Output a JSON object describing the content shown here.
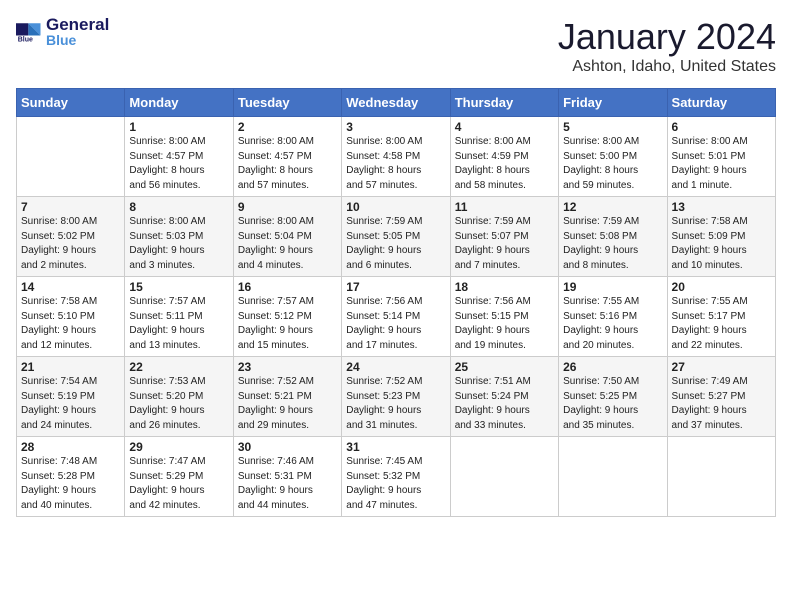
{
  "header": {
    "logo_general": "General",
    "logo_blue": "Blue",
    "month_title": "January 2024",
    "location": "Ashton, Idaho, United States"
  },
  "days_of_week": [
    "Sunday",
    "Monday",
    "Tuesday",
    "Wednesday",
    "Thursday",
    "Friday",
    "Saturday"
  ],
  "weeks": [
    [
      {
        "day": "",
        "detail": ""
      },
      {
        "day": "1",
        "detail": "Sunrise: 8:00 AM\nSunset: 4:57 PM\nDaylight: 8 hours\nand 56 minutes."
      },
      {
        "day": "2",
        "detail": "Sunrise: 8:00 AM\nSunset: 4:57 PM\nDaylight: 8 hours\nand 57 minutes."
      },
      {
        "day": "3",
        "detail": "Sunrise: 8:00 AM\nSunset: 4:58 PM\nDaylight: 8 hours\nand 57 minutes."
      },
      {
        "day": "4",
        "detail": "Sunrise: 8:00 AM\nSunset: 4:59 PM\nDaylight: 8 hours\nand 58 minutes."
      },
      {
        "day": "5",
        "detail": "Sunrise: 8:00 AM\nSunset: 5:00 PM\nDaylight: 8 hours\nand 59 minutes."
      },
      {
        "day": "6",
        "detail": "Sunrise: 8:00 AM\nSunset: 5:01 PM\nDaylight: 9 hours\nand 1 minute."
      }
    ],
    [
      {
        "day": "7",
        "detail": "Sunrise: 8:00 AM\nSunset: 5:02 PM\nDaylight: 9 hours\nand 2 minutes."
      },
      {
        "day": "8",
        "detail": "Sunrise: 8:00 AM\nSunset: 5:03 PM\nDaylight: 9 hours\nand 3 minutes."
      },
      {
        "day": "9",
        "detail": "Sunrise: 8:00 AM\nSunset: 5:04 PM\nDaylight: 9 hours\nand 4 minutes."
      },
      {
        "day": "10",
        "detail": "Sunrise: 7:59 AM\nSunset: 5:05 PM\nDaylight: 9 hours\nand 6 minutes."
      },
      {
        "day": "11",
        "detail": "Sunrise: 7:59 AM\nSunset: 5:07 PM\nDaylight: 9 hours\nand 7 minutes."
      },
      {
        "day": "12",
        "detail": "Sunrise: 7:59 AM\nSunset: 5:08 PM\nDaylight: 9 hours\nand 8 minutes."
      },
      {
        "day": "13",
        "detail": "Sunrise: 7:58 AM\nSunset: 5:09 PM\nDaylight: 9 hours\nand 10 minutes."
      }
    ],
    [
      {
        "day": "14",
        "detail": "Sunrise: 7:58 AM\nSunset: 5:10 PM\nDaylight: 9 hours\nand 12 minutes."
      },
      {
        "day": "15",
        "detail": "Sunrise: 7:57 AM\nSunset: 5:11 PM\nDaylight: 9 hours\nand 13 minutes."
      },
      {
        "day": "16",
        "detail": "Sunrise: 7:57 AM\nSunset: 5:12 PM\nDaylight: 9 hours\nand 15 minutes."
      },
      {
        "day": "17",
        "detail": "Sunrise: 7:56 AM\nSunset: 5:14 PM\nDaylight: 9 hours\nand 17 minutes."
      },
      {
        "day": "18",
        "detail": "Sunrise: 7:56 AM\nSunset: 5:15 PM\nDaylight: 9 hours\nand 19 minutes."
      },
      {
        "day": "19",
        "detail": "Sunrise: 7:55 AM\nSunset: 5:16 PM\nDaylight: 9 hours\nand 20 minutes."
      },
      {
        "day": "20",
        "detail": "Sunrise: 7:55 AM\nSunset: 5:17 PM\nDaylight: 9 hours\nand 22 minutes."
      }
    ],
    [
      {
        "day": "21",
        "detail": "Sunrise: 7:54 AM\nSunset: 5:19 PM\nDaylight: 9 hours\nand 24 minutes."
      },
      {
        "day": "22",
        "detail": "Sunrise: 7:53 AM\nSunset: 5:20 PM\nDaylight: 9 hours\nand 26 minutes."
      },
      {
        "day": "23",
        "detail": "Sunrise: 7:52 AM\nSunset: 5:21 PM\nDaylight: 9 hours\nand 29 minutes."
      },
      {
        "day": "24",
        "detail": "Sunrise: 7:52 AM\nSunset: 5:23 PM\nDaylight: 9 hours\nand 31 minutes."
      },
      {
        "day": "25",
        "detail": "Sunrise: 7:51 AM\nSunset: 5:24 PM\nDaylight: 9 hours\nand 33 minutes."
      },
      {
        "day": "26",
        "detail": "Sunrise: 7:50 AM\nSunset: 5:25 PM\nDaylight: 9 hours\nand 35 minutes."
      },
      {
        "day": "27",
        "detail": "Sunrise: 7:49 AM\nSunset: 5:27 PM\nDaylight: 9 hours\nand 37 minutes."
      }
    ],
    [
      {
        "day": "28",
        "detail": "Sunrise: 7:48 AM\nSunset: 5:28 PM\nDaylight: 9 hours\nand 40 minutes."
      },
      {
        "day": "29",
        "detail": "Sunrise: 7:47 AM\nSunset: 5:29 PM\nDaylight: 9 hours\nand 42 minutes."
      },
      {
        "day": "30",
        "detail": "Sunrise: 7:46 AM\nSunset: 5:31 PM\nDaylight: 9 hours\nand 44 minutes."
      },
      {
        "day": "31",
        "detail": "Sunrise: 7:45 AM\nSunset: 5:32 PM\nDaylight: 9 hours\nand 47 minutes."
      },
      {
        "day": "",
        "detail": ""
      },
      {
        "day": "",
        "detail": ""
      },
      {
        "day": "",
        "detail": ""
      }
    ]
  ]
}
